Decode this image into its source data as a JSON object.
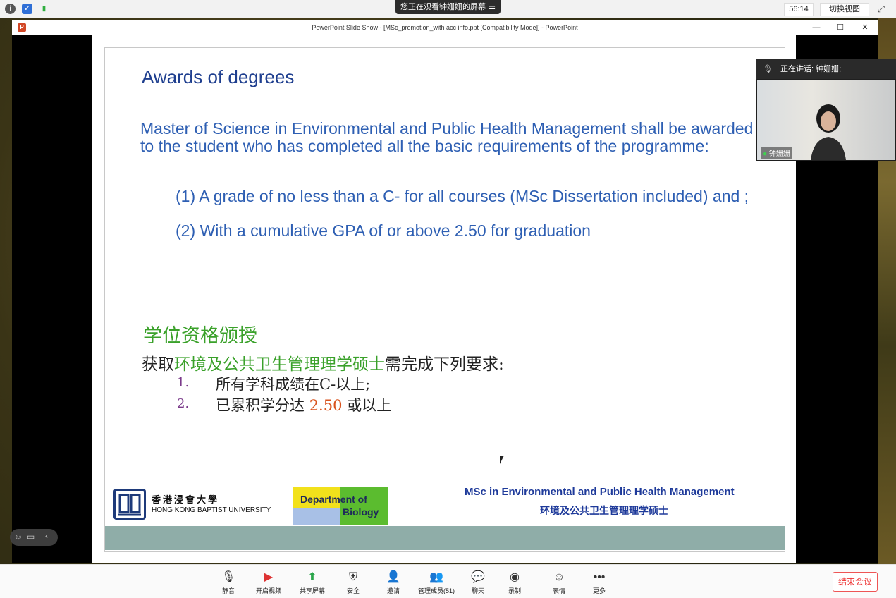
{
  "topbar": {
    "share_banner": "您正在观看钟姗姗的屏幕",
    "menu_icon": "menu-icon",
    "timer": "56:14",
    "switch_view": "切换视图"
  },
  "ppt": {
    "window_title": "PowerPoint Slide Show - [MSc_promotion_with acc info.ppt [Compatibility Mode]] - PowerPoint",
    "logo_letter": "P"
  },
  "slide": {
    "title": "Awards of degrees",
    "paragraph": "Master of Science in Environmental and Public Health Management shall be awarded to the student who has completed all the basic requirements of the programme:",
    "req1": "(1) A grade of no less than a C- for all courses (MSc Dissertation included) and ;",
    "req2": "(2) With a cumulative GPA of or above 2.50 for graduation",
    "cn_title": "学位资格颁授",
    "cn_line_pre": "获取",
    "cn_line_green": "环境及公共卫生管理理学硕士",
    "cn_line_post": "需完成下列要求:",
    "cn_num1": "1.",
    "cn_item1": "所有学科成绩在C-以上;",
    "cn_num2": "2.",
    "cn_item2_pre": "已累积学分达 ",
    "cn_item2_orange": "2.50",
    "cn_item2_post": " 或以上",
    "hkbu_cn": "香港浸會大學",
    "hkbu_en": "HONG KONG BAPTIST UNIVERSITY",
    "dept1": "Department of",
    "dept2": "Biology",
    "footer_en": "MSc in Environmental and Public Health Management",
    "footer_cn": "环境及公共卫生管理理学硕士"
  },
  "speaker": {
    "talking": "正在讲话: 钟姗姗;",
    "name": "钟姗姗"
  },
  "toolbar": {
    "mute": "静音",
    "video": "开启视频",
    "share": "共享屏幕",
    "security": "安全",
    "invite": "邀请",
    "participants": "管理成员(51)",
    "chat": "聊天",
    "record": "录制",
    "reactions": "表情",
    "more": "更多",
    "end": "结束会议"
  }
}
